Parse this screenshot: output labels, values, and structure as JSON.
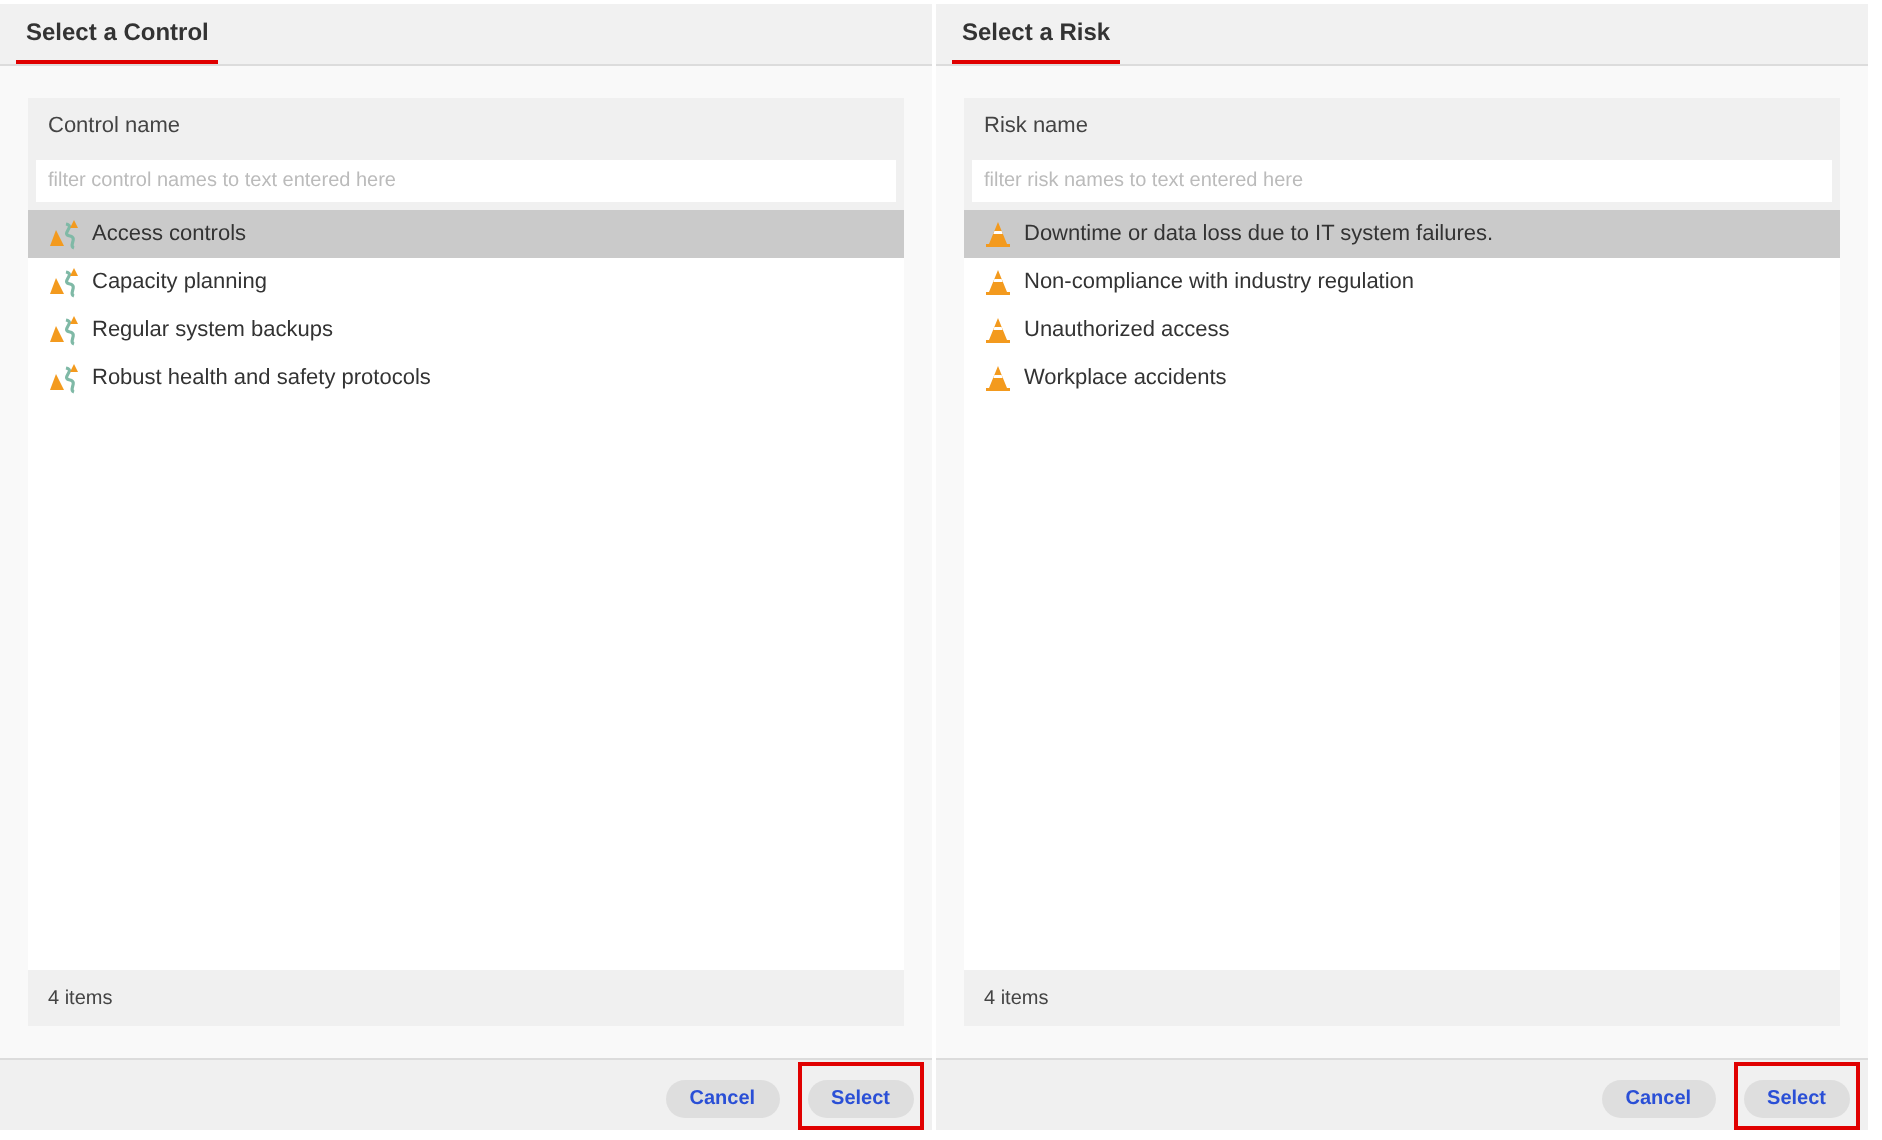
{
  "dialogs": [
    {
      "title": "Select a Control",
      "title_marked": true,
      "column_header": "Control name",
      "filter": {
        "placeholder": "filter control names to text entered here"
      },
      "kind": "control",
      "items": [
        {
          "label": "Access controls",
          "selected": true
        },
        {
          "label": "Capacity planning",
          "selected": false
        },
        {
          "label": "Regular system backups",
          "selected": false
        },
        {
          "label": "Robust health and safety protocols",
          "selected": false
        }
      ],
      "count": "4 items",
      "buttons": [
        {
          "label": "Cancel",
          "marked": false
        },
        {
          "label": "Select",
          "marked": true
        }
      ]
    },
    {
      "title": "Select a Risk",
      "title_marked": true,
      "column_header": "Risk name",
      "filter": {
        "placeholder": "filter risk names to text entered here"
      },
      "kind": "risk",
      "items": [
        {
          "label": "Downtime or data loss due to IT system failures.",
          "selected": true
        },
        {
          "label": "Non-compliance with industry regulation",
          "selected": false
        },
        {
          "label": "Unauthorized access",
          "selected": false
        },
        {
          "label": "Workplace accidents",
          "selected": false
        }
      ],
      "count": "4 items",
      "buttons": [
        {
          "label": "Cancel",
          "marked": false
        },
        {
          "label": "Select",
          "marked": true
        }
      ]
    }
  ]
}
